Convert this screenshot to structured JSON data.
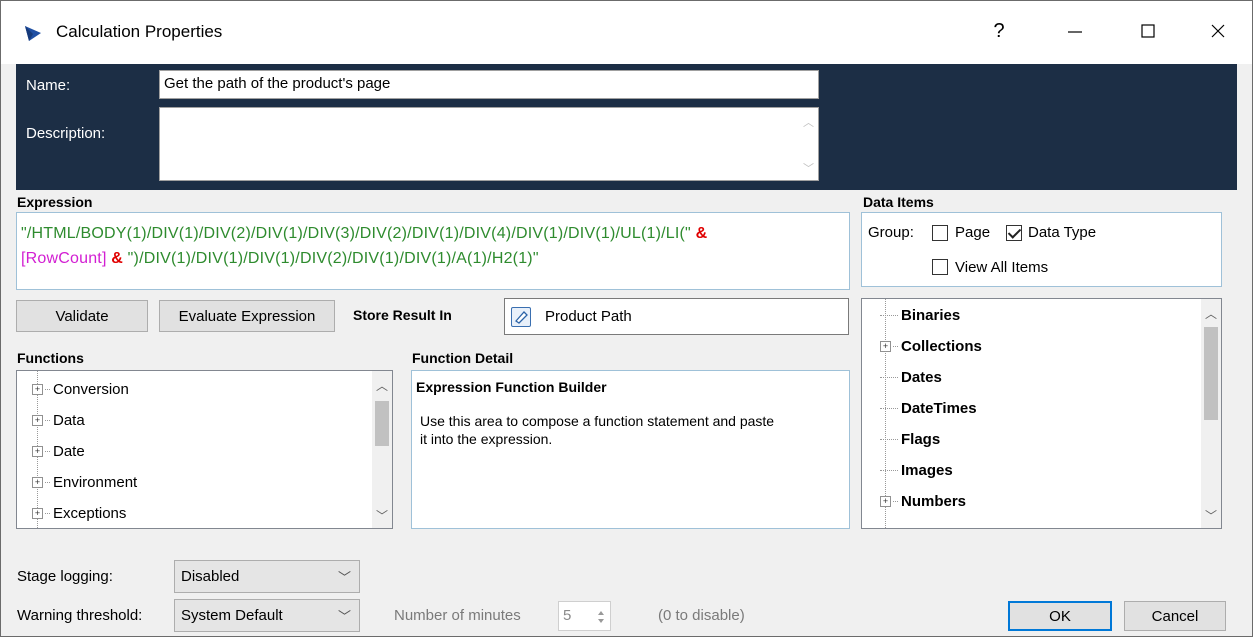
{
  "window": {
    "title": "Calculation Properties",
    "help": "?",
    "minimize": "—",
    "maximize": "☐",
    "close": "✕"
  },
  "header": {
    "name_label": "Name:",
    "name_value": "Get the path of the product's page",
    "description_label": "Description:",
    "description_value": ""
  },
  "expression": {
    "title": "Expression",
    "line1_text": "\"/HTML/BODY(1)/DIV(1)/DIV(2)/DIV(1)/DIV(3)/DIV(2)/DIV(1)/DIV(4)/DIV(1)/DIV(1)/UL(1)/LI(\"",
    "amp1": "&",
    "variable": "[RowCount]",
    "amp2": "&",
    "line2_text": "\")/DIV(1)/DIV(1)/DIV(1)/DIV(2)/DIV(1)/DIV(1)/A(1)/H2(1)\""
  },
  "data_items": {
    "title": "Data Items",
    "group_label": "Group:",
    "page_label": "Page",
    "page_checked": false,
    "data_type_label": "Data Type",
    "data_type_checked": true,
    "view_all_label": "View All Items",
    "view_all_checked": false,
    "tree": [
      {
        "label": "Binaries",
        "expandable": false
      },
      {
        "label": "Collections",
        "expandable": true
      },
      {
        "label": "Dates",
        "expandable": false
      },
      {
        "label": "DateTimes",
        "expandable": false
      },
      {
        "label": "Flags",
        "expandable": false
      },
      {
        "label": "Images",
        "expandable": false
      },
      {
        "label": "Numbers",
        "expandable": true
      }
    ]
  },
  "buttons": {
    "validate": "Validate",
    "evaluate": "Evaluate Expression",
    "ok": "OK",
    "cancel": "Cancel"
  },
  "store_result": {
    "label": "Store Result In",
    "value": "Product Path"
  },
  "functions": {
    "title": "Functions",
    "items": [
      {
        "label": "Conversion"
      },
      {
        "label": "Data"
      },
      {
        "label": "Date"
      },
      {
        "label": "Environment"
      },
      {
        "label": "Exceptions"
      }
    ]
  },
  "function_detail": {
    "title": "Function Detail",
    "heading": "Expression Function Builder",
    "line1": "Use this area to compose a function statement and paste",
    "line2": "it into the expression."
  },
  "bottom": {
    "stage_logging_label": "Stage logging:",
    "stage_logging_value": "Disabled",
    "warning_threshold_label": "Warning threshold:",
    "warning_threshold_value": "System Default",
    "minutes_label": "Number of minutes",
    "minutes_value": "5",
    "minutes_hint": "(0 to disable)"
  },
  "colors": {
    "header_bg": "#1c2e45",
    "expression_string": "#2e8b2e",
    "expression_variable": "#d21ed2",
    "expression_operator": "#e00000",
    "ok_border": "#0078d7"
  }
}
